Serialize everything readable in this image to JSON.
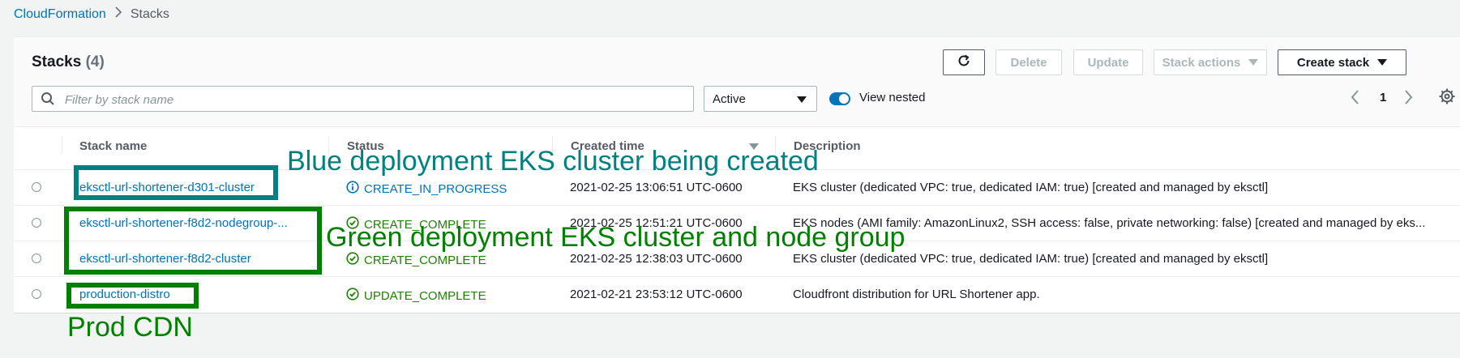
{
  "breadcrumb": {
    "root": "CloudFormation",
    "current": "Stacks"
  },
  "panel": {
    "title": "Stacks",
    "count": "(4)",
    "buttons": {
      "delete": "Delete",
      "update": "Update",
      "stack_actions": "Stack actions",
      "create_stack": "Create stack"
    },
    "filter_placeholder": "Filter by stack name",
    "status_filter": "Active",
    "view_nested_label": "View nested",
    "page": "1"
  },
  "columns": {
    "name": "Stack name",
    "status": "Status",
    "created": "Created time",
    "description": "Description"
  },
  "rows": [
    {
      "name": "eksctl-url-shortener-d301-cluster",
      "status": "CREATE_IN_PROGRESS",
      "created": "2021-02-25 13:06:51 UTC-0600",
      "description": "EKS cluster (dedicated VPC: true, dedicated IAM: true) [created and managed by eksctl]"
    },
    {
      "name": "eksctl-url-shortener-f8d2-nodegroup-...",
      "status": "CREATE_COMPLETE",
      "created": "2021-02-25 12:51:21 UTC-0600",
      "description": "EKS nodes (AMI family: AmazonLinux2, SSH access: false, private networking: false) [created and managed by eks..."
    },
    {
      "name": "eksctl-url-shortener-f8d2-cluster",
      "status": "CREATE_COMPLETE",
      "created": "2021-02-25 12:38:03 UTC-0600",
      "description": "EKS cluster (dedicated VPC: true, dedicated IAM: true) [created and managed by eksctl]"
    },
    {
      "name": "production-distro",
      "status": "UPDATE_COMPLETE",
      "created": "2021-02-21 23:53:12 UTC-0600",
      "description": "Cloudfront distribution for URL Shortener app."
    }
  ],
  "annotations": {
    "blue": "Blue deployment EKS cluster being created",
    "green": "Green deployment EKS cluster and node group",
    "prod": "Prod CDN"
  },
  "colors": {
    "link": "#0073bb",
    "success": "#1d8102",
    "blue_annotation": "#008080",
    "green_annotation": "#008000"
  }
}
